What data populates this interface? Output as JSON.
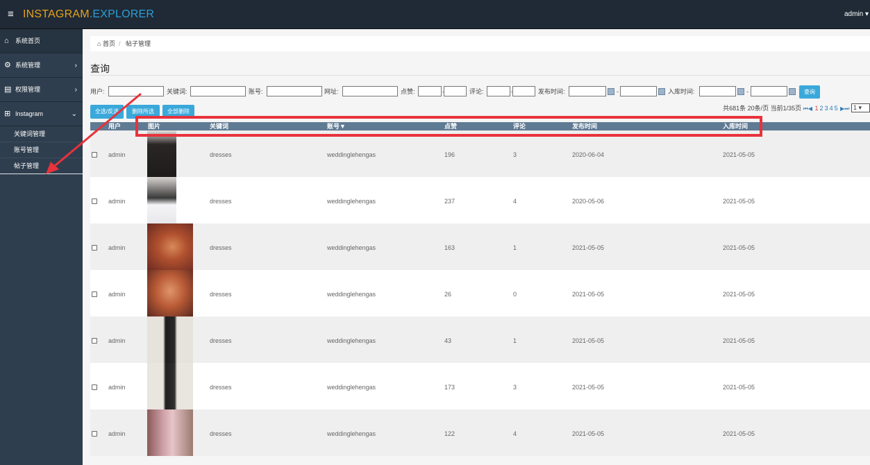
{
  "app": {
    "brand_part1": "INSTAGRAM",
    "brand_part2": ".EXPLORER",
    "user": "admin ▾"
  },
  "sidebar": {
    "items": [
      {
        "label": "系统首页",
        "icon": "home-icon"
      },
      {
        "label": "系统管理",
        "icon": "gear-icon"
      },
      {
        "label": "权限管理",
        "icon": "id-card-icon"
      },
      {
        "label": "Instagram",
        "icon": "sitemap-icon"
      }
    ],
    "sub_items": [
      "关键词管理",
      "账号管理",
      "帖子管理"
    ]
  },
  "breadcrumb": {
    "home": "首页",
    "current": "帖子管理"
  },
  "page": {
    "title": "查询"
  },
  "filters": {
    "user": "用户:",
    "keyword": "关键词:",
    "account": "账号:",
    "url": "网址:",
    "likes": "点赞:",
    "comments": "评论:",
    "publish_time": "发布时间:",
    "storage_time": "入库时间:",
    "dash": "-",
    "query_button": "查询"
  },
  "actions": {
    "toggle_select": "全选/反选",
    "delete_selected": "删除所选",
    "delete_all": "全部删除"
  },
  "pagination": {
    "summary": "共681条 20条/页 当前1/35页",
    "pages": [
      "1",
      "2",
      "3",
      "4",
      "5"
    ],
    "current_page": "1",
    "selected": "1"
  },
  "table": {
    "headers": [
      "用户",
      "图片",
      "关键词",
      "账号▼",
      "点赞",
      "评论",
      "发布时间",
      "入库时间"
    ],
    "rows": [
      {
        "user": "admin",
        "keyword": "dresses",
        "account": "weddinglehengas",
        "likes": "196",
        "comments": "3",
        "published": "2020-06-04",
        "stored": "2021-05-05"
      },
      {
        "user": "admin",
        "keyword": "dresses",
        "account": "weddinglehengas",
        "likes": "237",
        "comments": "4",
        "published": "2020-05-06",
        "stored": "2021-05-05"
      },
      {
        "user": "admin",
        "keyword": "dresses",
        "account": "weddinglehengas",
        "likes": "163",
        "comments": "1",
        "published": "2021-05-05",
        "stored": "2021-05-05"
      },
      {
        "user": "admin",
        "keyword": "dresses",
        "account": "weddinglehengas",
        "likes": "26",
        "comments": "0",
        "published": "2021-05-05",
        "stored": "2021-05-05"
      },
      {
        "user": "admin",
        "keyword": "dresses",
        "account": "weddinglehengas",
        "likes": "43",
        "comments": "1",
        "published": "2021-05-05",
        "stored": "2021-05-05"
      },
      {
        "user": "admin",
        "keyword": "dresses",
        "account": "weddinglehengas",
        "likes": "173",
        "comments": "3",
        "published": "2021-05-05",
        "stored": "2021-05-05"
      },
      {
        "user": "admin",
        "keyword": "dresses",
        "account": "weddinglehengas",
        "likes": "122",
        "comments": "4",
        "published": "2021-05-05",
        "stored": "2021-05-05"
      }
    ]
  },
  "colors": {
    "annotation_red": "#e8323c",
    "accent_blue": "#3aa8da",
    "header_bg": "#1f2a36",
    "sidebar_bg": "#2f3e4e"
  }
}
